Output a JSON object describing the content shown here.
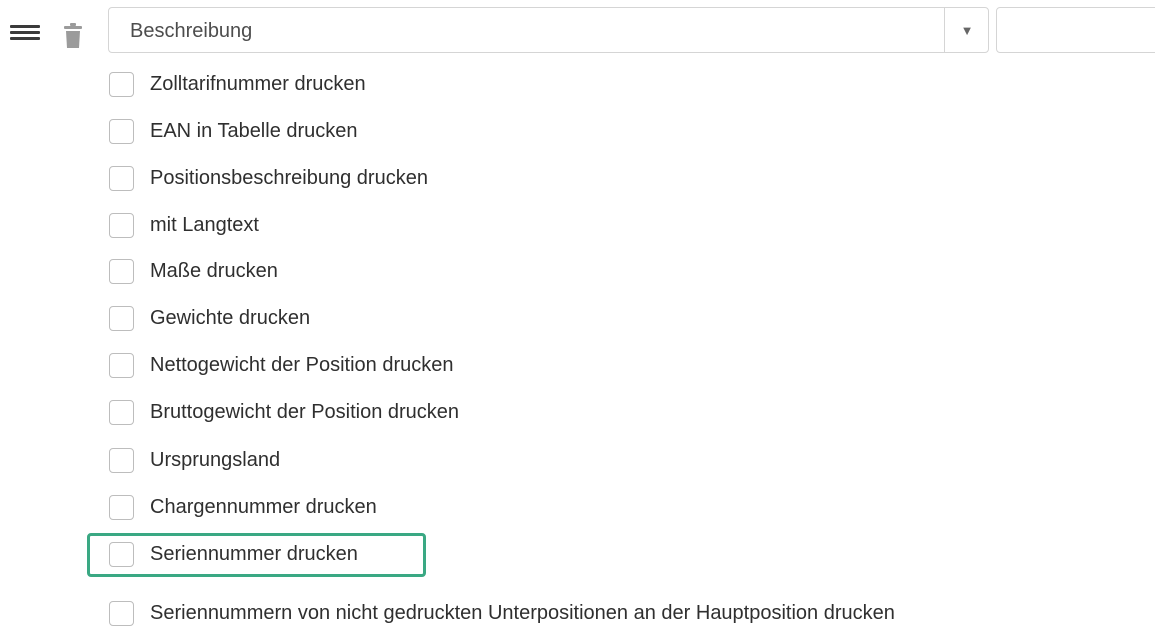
{
  "toolbar": {
    "menu_icon": "menu-icon",
    "delete_icon": "trash-icon"
  },
  "select": {
    "value": "Beschreibung",
    "arrow": "▼"
  },
  "side_input": {
    "value": ""
  },
  "options": [
    {
      "label": "Zolltarifnummer drucken",
      "checked": false
    },
    {
      "label": "EAN in Tabelle drucken",
      "checked": false
    },
    {
      "label": "Positionsbeschreibung drucken",
      "checked": false
    },
    {
      "label": "mit Langtext",
      "checked": false
    },
    {
      "label": "Maße drucken",
      "checked": false
    },
    {
      "label": "Gewichte drucken",
      "checked": false
    },
    {
      "label": "Nettogewicht der Position drucken",
      "checked": false
    },
    {
      "label": "Bruttogewicht der Position drucken",
      "checked": false
    },
    {
      "label": "Ursprungsland",
      "checked": false
    },
    {
      "label": "Chargennummer drucken",
      "checked": false
    },
    {
      "label": "Seriennummer drucken",
      "checked": false,
      "highlighted": true
    },
    {
      "label": "Seriennummern von nicht gedruckten Unterpositionen an der Hauptposition drucken",
      "checked": false
    }
  ],
  "colors": {
    "highlight": "#3aa883",
    "border": "#d5d5d5",
    "text": "#2f2f2f"
  }
}
